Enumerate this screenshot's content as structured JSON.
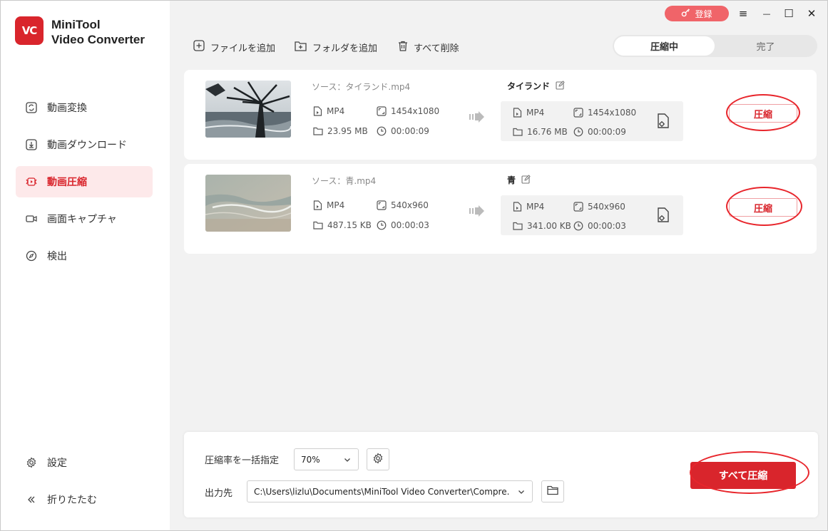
{
  "app": {
    "logo_text": "VC",
    "brand_line1": "MiniTool",
    "brand_line2": "Video Converter"
  },
  "titlebar": {
    "register_label": "登録",
    "menu": "≡",
    "minimize": "—",
    "maximize": "☐",
    "close": "✕"
  },
  "sidebar": {
    "items": [
      {
        "label": "動画変換"
      },
      {
        "label": "動画ダウンロード"
      },
      {
        "label": "動画圧縮"
      },
      {
        "label": "画面キャプチャ"
      },
      {
        "label": "検出"
      }
    ],
    "settings": "設定",
    "collapse": "折りたたむ"
  },
  "toolbar": {
    "add_file": "ファイルを追加",
    "add_folder": "フォルダを追加",
    "delete_all": "すべて削除"
  },
  "tabs": {
    "compressing": "圧縮中",
    "done": "完了"
  },
  "files": [
    {
      "source_prefix": "ソース：",
      "source_name": "タイランド.mp4",
      "format": "MP4",
      "resolution": "1454x1080",
      "size": "23.95 MB",
      "duration": "00:00:09",
      "output_name": "タイランド",
      "out_format": "MP4",
      "out_resolution": "1454x1080",
      "out_size": "16.76 MB",
      "out_duration": "00:00:09",
      "compress_label": "圧縮"
    },
    {
      "source_prefix": "ソース：",
      "source_name": "青.mp4",
      "format": "MP4",
      "resolution": "540x960",
      "size": "487.15 KB",
      "duration": "00:00:03",
      "output_name": "青",
      "out_format": "MP4",
      "out_resolution": "540x960",
      "out_size": "341.00 KB",
      "out_duration": "00:00:03",
      "compress_label": "圧縮"
    }
  ],
  "bottom": {
    "ratio_label": "圧縮率を一括指定",
    "ratio_value": "70%",
    "output_label": "出力先",
    "output_path": "C:\\Users\\lizlu\\Documents\\MiniTool Video Converter\\Compre.",
    "compress_all_label": "すべて圧縮"
  },
  "colors": {
    "accent": "#d9252c",
    "annotation": "#e8262c",
    "active_bg": "#fde9ea"
  }
}
